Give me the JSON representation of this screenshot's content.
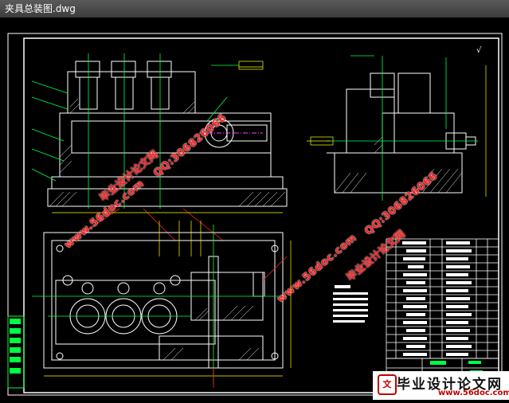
{
  "window": {
    "title": "夹具总装图.dwg"
  },
  "drawing": {
    "roughness_symbol": "√",
    "watermarks": {
      "site": "www.56doc.com",
      "qq": "QQ:306826066",
      "brand": "毕业设计论文网"
    }
  },
  "footer": {
    "brand": "毕业设计论文网",
    "url": "www.56doc.com"
  },
  "colors": {
    "background": "#000000",
    "line_white": "#ffffff",
    "line_green": "#00ff40",
    "line_yellow": "#ffff00",
    "line_cyan": "#00ffff",
    "line_magenta": "#ff40ff",
    "watermark_red": "#ff2020"
  }
}
